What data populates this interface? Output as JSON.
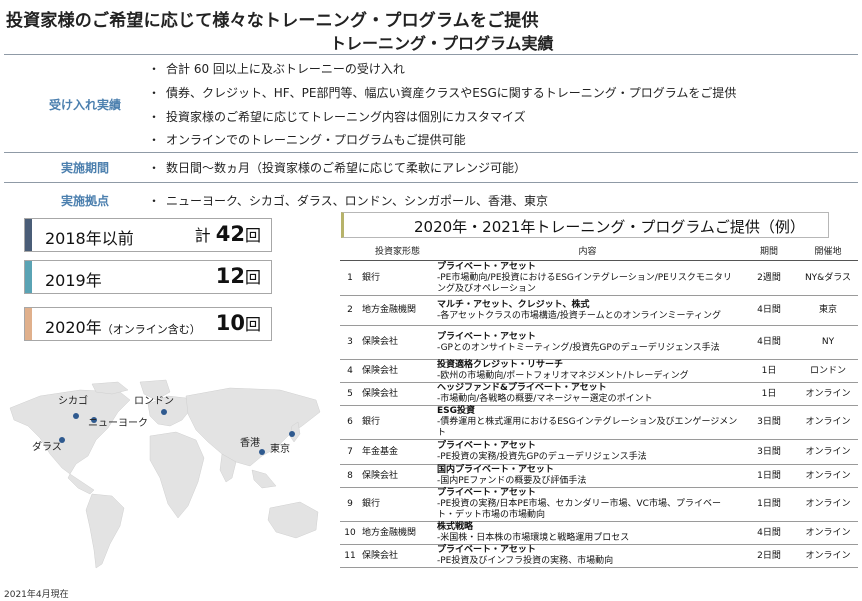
{
  "title": {
    "line1": "投資家様のご希望に応じて様々なトレーニング・プログラムをご提供",
    "line2": "トレーニング・プログラム実績"
  },
  "sections": [
    {
      "label": "受け入れ実績",
      "bullets": [
        "合計 60 回以上に及ぶトレーニーの受け入れ",
        "債券、クレジット、HF、PE部門等、幅広い資産クラスやESGに関するトレーニング・プログラムをご提供",
        "投資家様のご希望に応じてトレーニング内容は個別にカスタマイズ",
        "オンラインでのトレーニング・プログラムもご提供可能"
      ]
    },
    {
      "label": "実施期間",
      "bullets": [
        "数日間～数ヵ月（投資家様のご希望に応じて柔軟にアレンジ可能）"
      ]
    },
    {
      "label": "実施拠点",
      "bullets": [
        "ニューヨーク、シカゴ、ダラス、ロンドン、シンガポール、香港、東京"
      ]
    }
  ],
  "bullet_mark": "・",
  "summary": [
    {
      "year": "2018年以前",
      "year_note": "",
      "prefix": "計 ",
      "count": "42",
      "unit": "回",
      "color": "#4a5d77"
    },
    {
      "year": "2019年",
      "year_note": "",
      "prefix": "",
      "count": "12",
      "unit": "回",
      "color": "#5aa3b4"
    },
    {
      "year": "2020年",
      "year_note": "（オンライン含む）",
      "prefix": "",
      "count": "10",
      "unit": "回",
      "color": "#e0b08c"
    }
  ],
  "map": {
    "cities": [
      "シカゴ",
      "ロンドン",
      "ニューヨーク",
      "ダラス",
      "香港",
      "東京"
    ],
    "dot_color": "#2f5a8f"
  },
  "as_of": "2021年4月現在",
  "table": {
    "title": "2020年・2021年トレーニング・プログラムご提供（例）",
    "headers": [
      "",
      "投資家形態",
      "内容",
      "期間",
      "開催地"
    ],
    "rows": [
      {
        "no": "1",
        "type": "銀行",
        "content_head": "プライベート・アセット",
        "content_body": "-PE市場動向/PE投資におけるESGインテグレーション/PEリスクモニタリング及びオペレーション",
        "period": "2週間",
        "place": "NY&ダラス"
      },
      {
        "no": "2",
        "type": "地方金融機関",
        "content_head": "マルチ・アセット、クレジット、株式",
        "content_body": "-各アセットクラスの市場構造/投資チームとのオンラインミーティング",
        "period": "4日間",
        "place": "東京"
      },
      {
        "no": "3",
        "type": "保険会社",
        "content_head": "プライベート・アセット",
        "content_body": "-GPとのオンサイトミーティング/投資先GPのデューデリジェンス手法",
        "period": "4日間",
        "place": "NY"
      },
      {
        "no": "4",
        "type": "保険会社",
        "content_head": "投資適格クレジット・リサーチ",
        "content_body": "-欧州の市場動向/ポートフォリオマネジメント/トレーディング",
        "period": "1日",
        "place": "ロンドン"
      },
      {
        "no": "5",
        "type": "保険会社",
        "content_head": "ヘッジファンド&プライベート・アセット",
        "content_body": "-市場動向/各戦略の概要/マネージャー選定のポイント",
        "period": "1日",
        "place": "オンライン"
      },
      {
        "no": "6",
        "type": "銀行",
        "content_head": "ESG投資",
        "content_body": "-債券運用と株式運用におけるESGインテグレーション及びエンゲージメント",
        "period": "3日間",
        "place": "オンライン"
      },
      {
        "no": "7",
        "type": "年金基金",
        "content_head": "プライベート・アセット",
        "content_body": "-PE投資の実務/投資先GPのデューデリジェンス手法",
        "period": "3日間",
        "place": "オンライン"
      },
      {
        "no": "8",
        "type": "保険会社",
        "content_head": "国内プライベート・アセット",
        "content_body": "-国内PEファンドの概要及び評価手法",
        "period": "1日間",
        "place": "オンライン"
      },
      {
        "no": "9",
        "type": "銀行",
        "content_head": "プライベート・アセット",
        "content_body": "-PE投資の実務/日本PE市場、セカンダリー市場、VC市場、プライベート・デット市場の市場動向",
        "period": "1日間",
        "place": "オンライン"
      },
      {
        "no": "10",
        "type": "地方金融機関",
        "content_head": "株式戦略",
        "content_body": "-米国株・日本株の市場環境と戦略運用プロセス",
        "period": "4日間",
        "place": "オンライン"
      },
      {
        "no": "11",
        "type": "保険会社",
        "content_head": "プライベート・アセット",
        "content_body": "-PE投資及びインフラ投資の実務、市場動向",
        "period": "2日間",
        "place": "オンライン"
      }
    ]
  }
}
